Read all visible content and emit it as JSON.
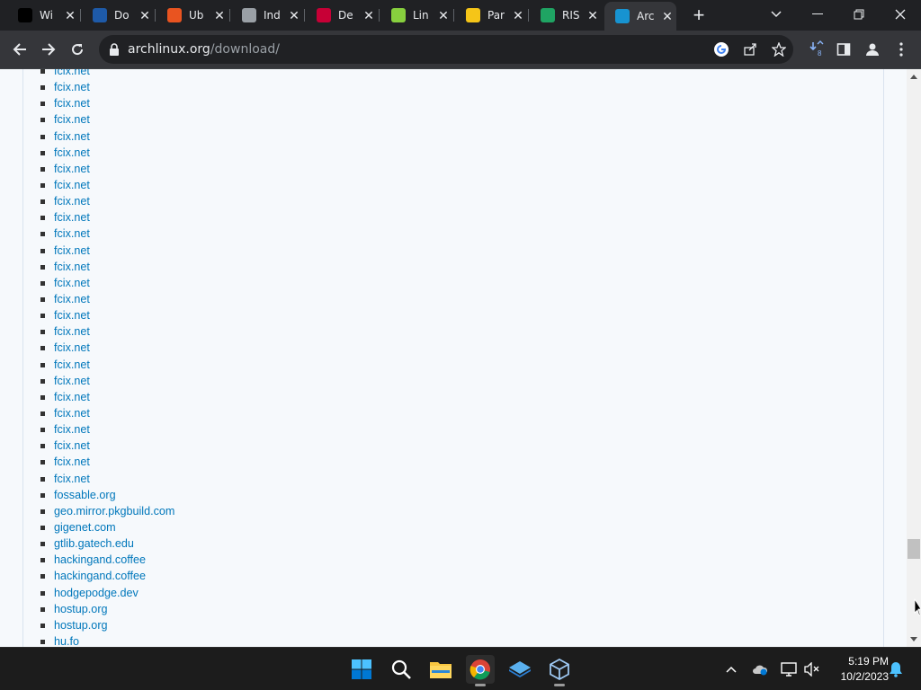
{
  "browser": {
    "tabs": [
      {
        "title": "Wi",
        "icon": "wikipedia-icon",
        "color": "#000000"
      },
      {
        "title": "Do",
        "icon": "document-icon",
        "color": "#1e5aa8"
      },
      {
        "title": "Ub",
        "icon": "ubuntu-icon",
        "color": "#e95420"
      },
      {
        "title": "Ind",
        "icon": "globe-icon",
        "color": "#9aa0a6"
      },
      {
        "title": "De",
        "icon": "debian-icon",
        "color": "#c70036"
      },
      {
        "title": "Lin",
        "icon": "linux-mint-icon",
        "color": "#87cf3e"
      },
      {
        "title": "Par",
        "icon": "parrot-icon",
        "color": "#f5c518"
      },
      {
        "title": "RIS",
        "icon": "google-drive-icon",
        "color": "#1fa463"
      },
      {
        "title": "Arc",
        "icon": "arch-linux-icon",
        "color": "#1793d1",
        "active": true
      }
    ],
    "url_host": "archlinux.org",
    "url_path": "/download/",
    "downloads_count": "8"
  },
  "page": {
    "mirrors": [
      "fcix.net",
      "fcix.net",
      "fcix.net",
      "fcix.net",
      "fcix.net",
      "fcix.net",
      "fcix.net",
      "fcix.net",
      "fcix.net",
      "fcix.net",
      "fcix.net",
      "fcix.net",
      "fcix.net",
      "fcix.net",
      "fcix.net",
      "fcix.net",
      "fcix.net",
      "fcix.net",
      "fcix.net",
      "fcix.net",
      "fcix.net",
      "fcix.net",
      "fcix.net",
      "fcix.net",
      "fcix.net",
      "fcix.net",
      "fossable.org",
      "geo.mirror.pkgbuild.com",
      "gigenet.com",
      "gtlib.gatech.edu",
      "hackingand.coffee",
      "hackingand.coffee",
      "hodgepodge.dev",
      "hostup.org",
      "hostup.org",
      "hu.fo"
    ]
  },
  "scroll": {
    "position_fraction": 0.86
  },
  "taskbar": {
    "apps": [
      "windows-start-icon",
      "search-icon",
      "file-explorer-icon",
      "chrome-icon",
      "layers-app-icon",
      "virtualbox-icon"
    ],
    "time": "5:19 PM",
    "date": "10/2/2023"
  }
}
